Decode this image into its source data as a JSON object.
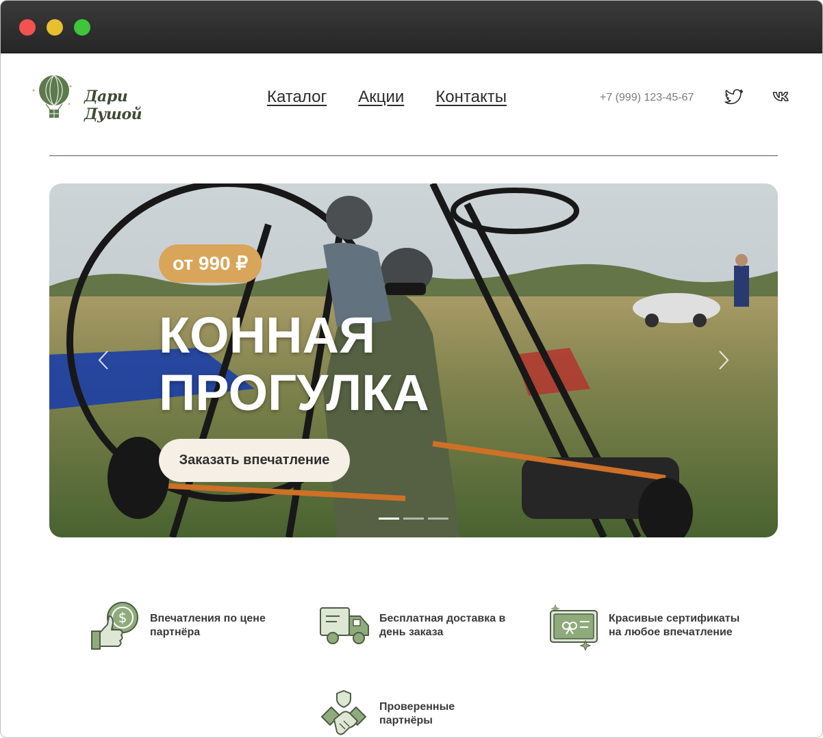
{
  "window": {
    "controls": [
      "close",
      "minimize",
      "maximize"
    ]
  },
  "header": {
    "logo_text": "Дари Душой",
    "nav": [
      {
        "label": "Каталог"
      },
      {
        "label": "Акции"
      },
      {
        "label": "Контакты"
      }
    ],
    "phone": "+7 (999) 123-45-67",
    "social": [
      "twitter-icon",
      "vk-icon"
    ]
  },
  "hero": {
    "price": "от 990 ₽",
    "title_line1": "КОННАЯ",
    "title_line2": "ПРОГУЛКА",
    "cta": "Заказать впечатление",
    "slides_total": 3,
    "active_slide": 1
  },
  "features": [
    {
      "icon": "thumbs-up-dollar-icon",
      "line1": "Впечатления по цене",
      "line2": "партнёра"
    },
    {
      "icon": "delivery-truck-icon",
      "line1": "Бесплатная доставка в",
      "line2": "день заказа"
    },
    {
      "icon": "gift-certificate-icon",
      "line1": "Красивые сертификаты",
      "line2": "на любое впечатление"
    },
    {
      "icon": "handshake-shield-icon",
      "line1": "Проверенные",
      "line2": "партнёры"
    }
  ],
  "colors": {
    "accent_green": "#6a8a5c",
    "dark_green": "#3e4a36",
    "price_badge": "#d9a55a",
    "cta_bg": "#f6efe6"
  }
}
